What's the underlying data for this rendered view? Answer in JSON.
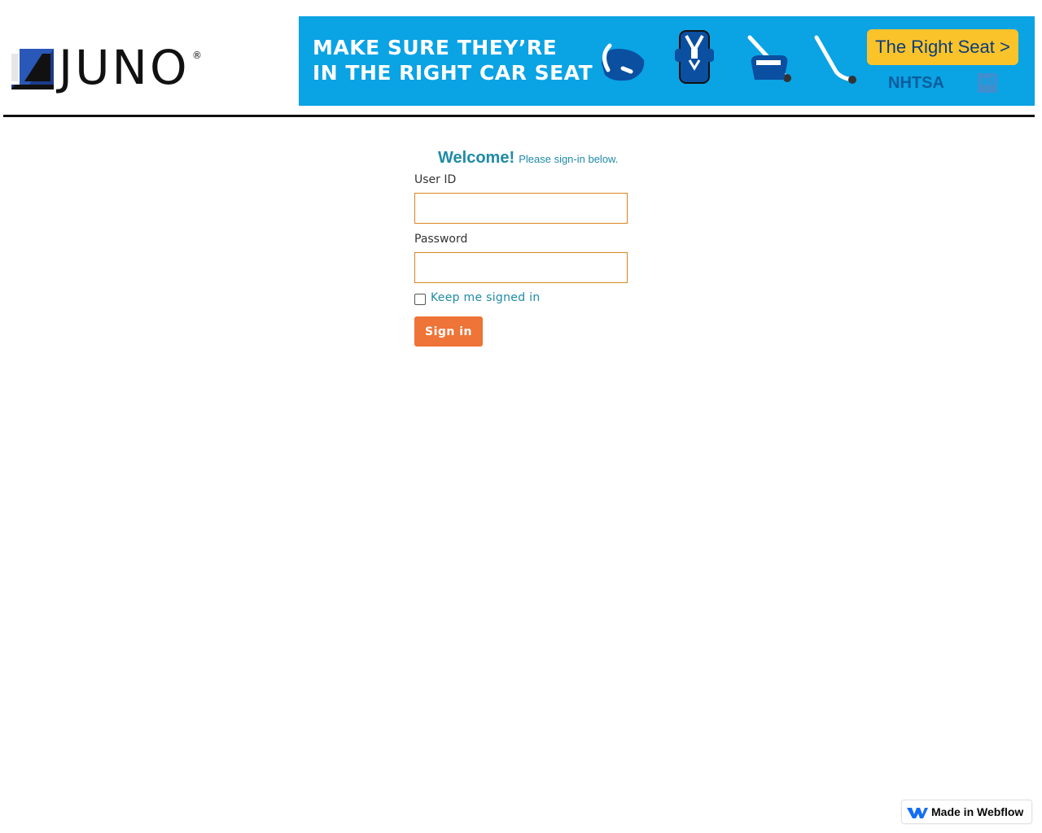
{
  "header": {
    "logo_text": "JUNO",
    "logo_registered": "®"
  },
  "banner": {
    "headline_line1": "MAKE SURE THEY’RE",
    "headline_line2": "IN THE RIGHT CAR SEAT",
    "cta_label": "The Right Seat >",
    "sponsor": "NHTSA",
    "ad_mark": "ad",
    "icons": [
      "infant-seat-icon",
      "harness-seat-icon",
      "booster-seat-icon",
      "seat-belt-icon"
    ],
    "background_color": "#0aa3e4",
    "cta_color": "#fbc32a"
  },
  "login": {
    "welcome": "Welcome!",
    "welcome_sub": "Please sign-in below.",
    "user_id_label": "User ID",
    "user_id_value": "",
    "password_label": "Password",
    "password_value": "",
    "keep_signed_in_label": "Keep me signed in",
    "keep_signed_in_checked": false,
    "sign_in_label": "Sign in",
    "accent_color": "#1f8aa6",
    "button_color": "#ee7437",
    "input_border_color": "#d9861f"
  },
  "footer": {
    "webflow_badge": "Made in Webflow"
  }
}
